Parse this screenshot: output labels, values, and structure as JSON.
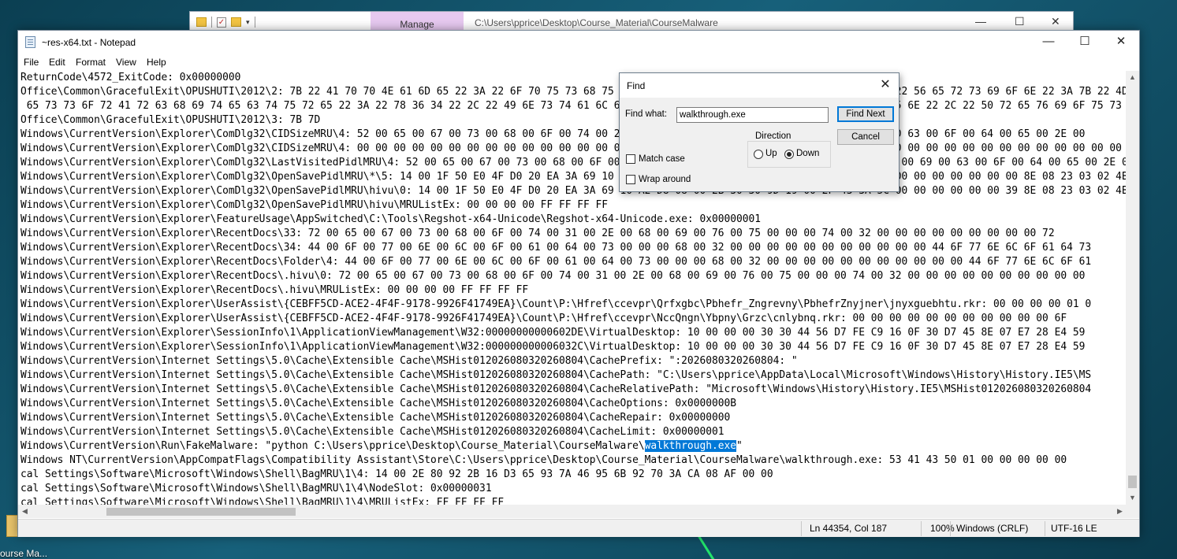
{
  "desktop": {
    "icon_label": "ourse Ma..."
  },
  "explorer": {
    "manage_tab": "Manage",
    "path": "C:\\Users\\pprice\\Desktop\\Course_Material\\CourseMalware",
    "min": "—",
    "max": "☐",
    "close": "✕"
  },
  "notepad": {
    "title": "~res-x64.txt - Notepad",
    "controls": {
      "min": "—",
      "max": "☐",
      "close": "✕"
    },
    "menu": [
      "File",
      "Edit",
      "Format",
      "View",
      "Help"
    ],
    "lines": [
      "ReturnCode\\4572_ExitCode: 0x00000000",
      "Office\\Common\\GracefulExit\\OPUSHUTI\\2012\\2: 7B 22 41 70 70 4E 61 6D 65 22 3A 22 6F 70 75 73 68 75 74 69 22 2C 22 53 65 73 73 69 6F 6E 22 3A 7B 22 56 65 72 73 69 6F 6E 22 3A 7B 22 4D 61",
      " 65 73 73 6F 72 41 72 63 68 69 74 65 63 74 75 72 65 22 3A 22 78 36 34 22 2C 22 49 6E 73 74 61 6C 6C 54 79 70 65 22 3A 22 43 6C 69 63 6B 32 52 75 6E 22 2C 22 50 72 65 76 69 6F 75 73 42 75 69 6C 64 22",
      "Office\\Common\\GracefulExit\\OPUSHUTI\\2012\\3: 7B 7D",
      "Windows\\CurrentVersion\\Explorer\\ComDlg32\\CIDSizeMRU\\4: 52 00 65 00 67 00 73 00 68 00 6F 00 74 00 2D 00 78 00 36 00 34 00 2D 00 55 00 6E 00 69 00 63 00 6F 00 64 00 65 00 2E 00",
      "Windows\\CurrentVersion\\Explorer\\ComDlg32\\CIDSizeMRU\\4: 00 00 00 00 00 00 00 00 00 00 00 00 00 00 00 00 00 00 00 00 00 00 00 00 00 00 00 00 00 00 00 00 00 00 00 00 00 00 00 00 00 00 00 00 00 00 00 00",
      "Windows\\CurrentVersion\\Explorer\\ComDlg32\\LastVisitedPidlMRU\\4: 52 00 65 00 67 00 73 00 68 00 6F 00 74 00 2D 00 78 00 36 00 34 00 2D 00 55 00 6E 00 69 00 63 00 6F 00 64 00 65 00 2E 00 6E 00 69 00 63 00 6F 00 64 00 65 00",
      "Windows\\CurrentVersion\\Explorer\\ComDlg32\\OpenSavePidlMRU\\*\\5: 14 00 1F 50 E0 4F D0 20 EA 3A 69 10 A2 D8 08 00 2B 30 30 9D 19 00 2F 43 3A 5C 00 00 00 00 00 00 00 00 8E 08 23 03 02 4B 98 26 5D 99 42 8E",
      "Windows\\CurrentVersion\\Explorer\\ComDlg32\\OpenSavePidlMRU\\hivu\\0: 14 00 1F 50 E0 4F D0 20 EA 3A 69 10 A2 D8 08 00 2B 30 30 9D 19 00 2F 43 3A 5C 00 00 00 00 00 00 39 8E 08 23 03 02 4B 98 26 5D 99 42",
      "Windows\\CurrentVersion\\Explorer\\ComDlg32\\OpenSavePidlMRU\\hivu\\MRUListEx: 00 00 00 00 FF FF FF FF",
      "Windows\\CurrentVersion\\Explorer\\FeatureUsage\\AppSwitched\\C:\\Tools\\Regshot-x64-Unicode\\Regshot-x64-Unicode.exe: 0x00000001",
      "Windows\\CurrentVersion\\Explorer\\RecentDocs\\33: 72 00 65 00 67 00 73 00 68 00 6F 00 74 00 31 00 2E 00 68 00 69 00 76 00 75 00 00 00 74 00 32 00 00 00 00 00 00 00 00 00 72",
      "Windows\\CurrentVersion\\Explorer\\RecentDocs\\34: 44 00 6F 00 77 00 6E 00 6C 00 6F 00 61 00 64 00 73 00 00 00 68 00 32 00 00 00 00 00 00 00 00 00 00 00 44 6F 77 6E 6C 6F 61 64 73",
      "Windows\\CurrentVersion\\Explorer\\RecentDocs\\Folder\\4: 44 00 6F 00 77 00 6E 00 6C 00 6F 00 61 00 64 00 73 00 00 00 68 00 32 00 00 00 00 00 00 00 00 00 00 00 44 6F 77 6E 6C 6F 61",
      "Windows\\CurrentVersion\\Explorer\\RecentDocs\\.hivu\\0: 72 00 65 00 67 00 73 00 68 00 6F 00 74 00 31 00 2E 00 68 00 69 00 76 00 75 00 00 00 74 00 32 00 00 00 00 00 00 00 00 00 00",
      "Windows\\CurrentVersion\\Explorer\\RecentDocs\\.hivu\\MRUListEx: 00 00 00 00 FF FF FF FF",
      "Windows\\CurrentVersion\\Explorer\\UserAssist\\{CEBFF5CD-ACE2-4F4F-9178-9926F41749EA}\\Count\\P:\\Hfref\\ccevpr\\Qrfxgbc\\Pbhefr_Zngrevny\\PbhefrZnyjner\\jnyxguebhtu.rkr: 00 00 00 00 01 0",
      "Windows\\CurrentVersion\\Explorer\\UserAssist\\{CEBFF5CD-ACE2-4F4F-9178-9926F41749EA}\\Count\\P:\\Hfref\\ccevpr\\NccQngn\\Ybpny\\Grzc\\cnlybnq.rkr: 00 00 00 00 00 00 00 00 00 00 00 6F",
      "Windows\\CurrentVersion\\Explorer\\SessionInfo\\1\\ApplicationViewManagement\\W32:00000000000602DE\\VirtualDesktop: 10 00 00 00 30 30 44 56 D7 FE C9 16 0F 30 D7 45 8E 07 E7 28 E4 59",
      "Windows\\CurrentVersion\\Explorer\\SessionInfo\\1\\ApplicationViewManagement\\W32:000000000006032C\\VirtualDesktop: 10 00 00 00 30 30 44 56 D7 FE C9 16 0F 30 D7 45 8E 07 E7 28 E4 59",
      "Windows\\CurrentVersion\\Internet Settings\\5.0\\Cache\\Extensible Cache\\MSHist012026080320260804\\CachePrefix: \":2026080320260804: \"",
      "Windows\\CurrentVersion\\Internet Settings\\5.0\\Cache\\Extensible Cache\\MSHist012026080320260804\\CachePath: \"C:\\Users\\pprice\\AppData\\Local\\Microsoft\\Windows\\History\\History.IE5\\MS",
      "Windows\\CurrentVersion\\Internet Settings\\5.0\\Cache\\Extensible Cache\\MSHist012026080320260804\\CacheRelativePath: \"Microsoft\\Windows\\History\\History.IE5\\MSHist012026080320260804",
      "Windows\\CurrentVersion\\Internet Settings\\5.0\\Cache\\Extensible Cache\\MSHist012026080320260804\\CacheOptions: 0x0000000B",
      "Windows\\CurrentVersion\\Internet Settings\\5.0\\Cache\\Extensible Cache\\MSHist012026080320260804\\CacheRepair: 0x00000000",
      "Windows\\CurrentVersion\\Internet Settings\\5.0\\Cache\\Extensible Cache\\MSHist012026080320260804\\CacheLimit: 0x00000001",
      "Windows NT\\CurrentVersion\\AppCompatFlags\\Compatibility Assistant\\Store\\C:\\Users\\pprice\\Desktop\\Course_Material\\CourseMalware\\walkthrough.exe: 53 41 43 50 01 00 00 00 00 00",
      "cal Settings\\Software\\Microsoft\\Windows\\Shell\\BagMRU\\1\\4: 14 00 2E 80 92 2B 16 D3 65 93 7A 46 95 6B 92 70 3A CA 08 AF 00 00",
      "cal Settings\\Software\\Microsoft\\Windows\\Shell\\BagMRU\\1\\4\\NodeSlot: 0x00000031",
      "cal Settings\\Software\\Microsoft\\Windows\\Shell\\BagMRU\\1\\4\\MRUListEx: FF FF FF FF"
    ],
    "run_line": {
      "prefix": "Windows\\CurrentVersion\\Run\\FakeMalware: \"python C:\\Users\\pprice\\Desktop\\Course_Material\\CourseMalware\\",
      "selected": "walkthrough.exe",
      "suffix": "\""
    },
    "status": {
      "position": "Ln 44354, Col 187",
      "zoom": "100%",
      "line_ending": "Windows (CRLF)",
      "encoding": "UTF-16 LE"
    }
  },
  "find_dialog": {
    "title": "Find",
    "find_what_label": "Find what:",
    "search_value": "walkthrough.exe",
    "find_next_button": "Find Next",
    "cancel_button": "Cancel",
    "direction_label": "Direction",
    "up_label": "Up",
    "down_label": "Down",
    "direction_selected": "Down",
    "match_case_label": "Match case",
    "match_case_checked": false,
    "wrap_around_label": "Wrap around",
    "wrap_around_checked": false,
    "close": "✕"
  },
  "colors": {
    "selection": "#0078d7",
    "manage_tab": "#e7c9f0",
    "default_button_border": "#0078d7"
  }
}
